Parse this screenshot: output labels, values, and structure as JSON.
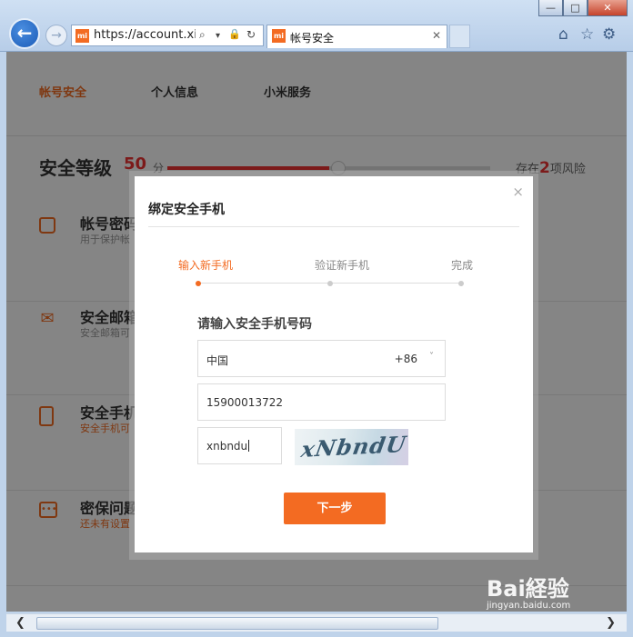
{
  "browser": {
    "url": "https://account.xi...",
    "tab_title": "帐号安全",
    "logo_text": "mi",
    "window_buttons": {
      "minimize": "—",
      "maximize": "□",
      "close": "✕"
    },
    "back_glyph": "←",
    "forward_glyph": "→",
    "addr_icons": {
      "search": "⌕",
      "dropdown": "▾",
      "lock": "🔒",
      "refresh": "↻"
    },
    "tab_close": "✕",
    "toolbar_icons": {
      "home": "⌂",
      "favorites": "☆",
      "settings": "⚙"
    }
  },
  "page": {
    "tabs": [
      "帐号安全",
      "个人信息",
      "小米服务"
    ],
    "active_tab_index": 0,
    "security_level": {
      "title": "安全等级",
      "score": "50",
      "unit": "分",
      "fraction": 0.5,
      "risk_prefix": "存在",
      "risk_count": "2",
      "risk_suffix": "项风险"
    },
    "items": [
      {
        "icon": "lock-icon",
        "glyph": "",
        "title": "帐号密码",
        "desc": "用于保护帐",
        "warn": false
      },
      {
        "icon": "mail-icon",
        "glyph": "✉",
        "title": "安全邮箱",
        "desc": "安全邮箱可",
        "warn": false
      },
      {
        "icon": "phone-icon",
        "glyph": "",
        "title": "安全手机",
        "desc": "安全手机可",
        "warn": true
      },
      {
        "icon": "question-icon",
        "glyph": "•••",
        "title": "密保问题",
        "desc": "还未有设置",
        "warn": true
      }
    ]
  },
  "modal": {
    "title": "绑定安全手机",
    "close": "×",
    "steps": [
      "输入新手机",
      "验证新手机",
      "完成"
    ],
    "active_step": 0,
    "heading": "请输入安全手机号码",
    "country": {
      "name": "中国",
      "code": "+86",
      "chevron": "˅"
    },
    "phone_value": "15900013722",
    "captcha_input_value": "xnbndu",
    "captcha_image_text": "xNbndU",
    "next_button": "下一步"
  },
  "scroll": {
    "left": "❮",
    "right": "❯"
  },
  "watermark": {
    "main": "Bai経验",
    "sub": "jingyan.baidu.com"
  },
  "colors": {
    "accent": "#f36b22",
    "danger": "#ee3333"
  }
}
